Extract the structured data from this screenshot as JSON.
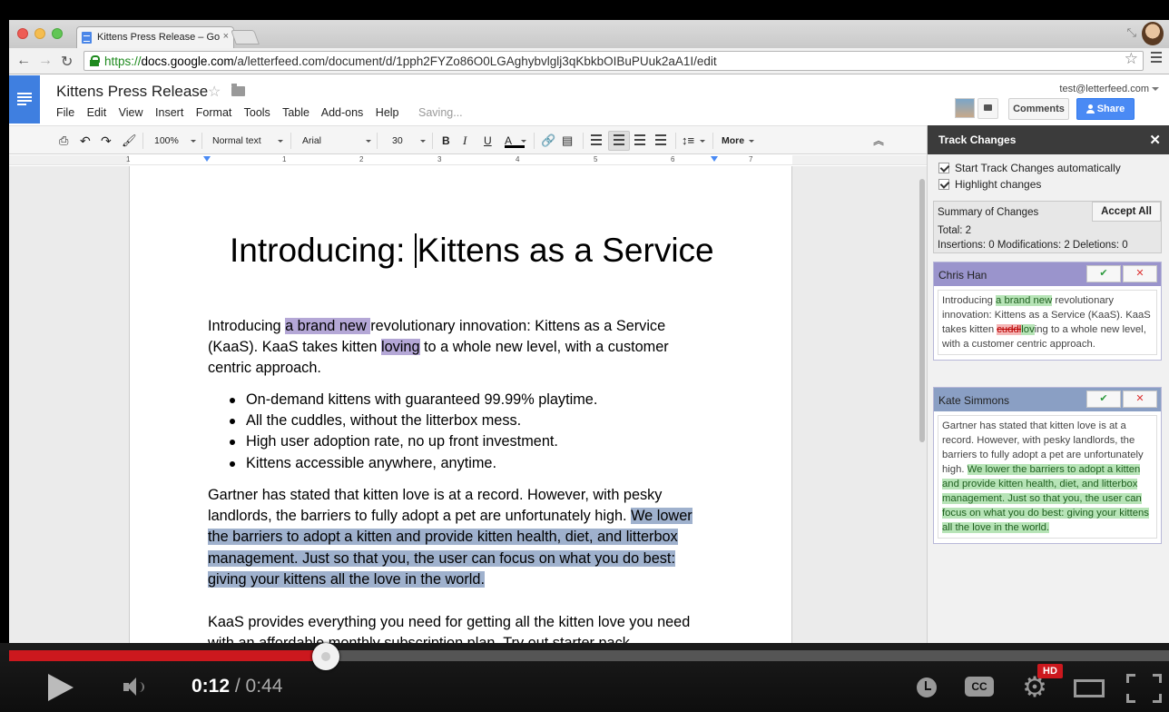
{
  "browser": {
    "tab_title": "Kittens Press Release – Go",
    "tab_close": "×",
    "url_scheme": "https://",
    "url_domain": "docs.google.com",
    "url_path": "/a/letterfeed.com/document/d/1pph2FYZo86O0LGAghybvlglj3qKbkbOIBuPUuk2aA1I/edit",
    "back": "←",
    "forward": "→",
    "reload": "↻",
    "star": "☆"
  },
  "docs": {
    "title": "Kittens Press Release",
    "title_star": "☆",
    "menu": [
      "File",
      "Edit",
      "View",
      "Insert",
      "Format",
      "Tools",
      "Table",
      "Add-ons",
      "Help"
    ],
    "status": "Saving...",
    "account_email": "test@letterfeed.com",
    "comments_label": "Comments",
    "share_label": "Share"
  },
  "toolbar": {
    "zoom": "100%",
    "style": "Normal text",
    "font": "Arial",
    "size": "30",
    "bold": "B",
    "italic": "I",
    "underline": "U",
    "text_color": "A",
    "more": "More",
    "collapse": "︽"
  },
  "ruler": {
    "numbers": [
      "1",
      "1",
      "2",
      "3",
      "4",
      "5",
      "6",
      "7"
    ]
  },
  "document": {
    "heading_before_cursor": "Introducing: ",
    "heading_after_cursor": "Kittens as a Service",
    "p1": {
      "a": "Introducing ",
      "hl1": "a brand new ",
      "b": "revolutionary innovation: Kittens as a Service (KaaS). KaaS takes kitten ",
      "hl2": "loving",
      "c": " to a whole new level, with a customer centric approach."
    },
    "bullets": [
      "On-demand kittens with guaranteed 99.99% playtime.",
      "All the cuddles, without the litterbox mess.",
      "High user adoption rate, no up front investment.",
      "Kittens accessible anywhere, anytime."
    ],
    "p2": {
      "a": "Gartner has stated that kitten love is at a record. However, with pesky landlords, the barriers to fully adopt a pet are unfortunately high. ",
      "hl": "We lower the barriers to adopt a kitten and provide kitten health, diet, and litterbox management. Just so that you, the user can focus on what you do best: giving your kittens all the love in the world."
    },
    "p3": "KaaS provides everything you need for getting all the kitten love you need with an affordable monthly subscription plan. Try out starter pack"
  },
  "track_changes": {
    "title": "Track Changes",
    "close": "✕",
    "option_auto": "Start Track Changes automatically",
    "option_highlight": "Highlight changes",
    "summary_title": "Summary of Changes",
    "accept_all": "Accept All",
    "total": "Total: 2",
    "counts": "Insertions: 0 Modifications: 2 Deletions: 0",
    "accept_symbol": "✔",
    "reject_symbol": "✕",
    "changes": [
      {
        "author": "Chris Han",
        "t1": "Introducing ",
        "ins1": "a brand new",
        "t2": " revolutionary innovation: Kittens as a Service (KaaS). KaaS takes kitten ",
        "del": "cuddl",
        "ins2": "lov",
        "t3": "ing to a whole new level, with a customer centric approach."
      },
      {
        "author": "Kate Simmons",
        "t1": "Gartner has stated that kitten love is at a record. However, with pesky landlords, the barriers to fully adopt a pet are unfortunately high. ",
        "ins1": "We lower the barriers to adopt a kitten and provide kitten health, diet, and litterbox management. Just so that you, the user can focus on what you do best: giving your kittens all the love in the world."
      }
    ]
  },
  "video": {
    "current_time": "0:12",
    "separator": " / ",
    "duration": "0:44",
    "progress_fraction": 0.273,
    "cc": "CC",
    "hd": "HD",
    "settings": "⚙"
  },
  "colors": {
    "insert_highlight": "#b4a7d6",
    "modify_highlight": "#9fb1cd",
    "progress_red": "#cc181e",
    "share_blue": "#4a8af4"
  }
}
